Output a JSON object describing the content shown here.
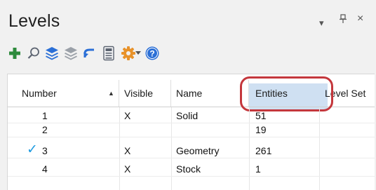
{
  "panel": {
    "title": "Levels",
    "dropdown_glyph": "▾",
    "pin_glyph": "ᚚ",
    "close_glyph": "×"
  },
  "toolbar": {
    "icons": [
      "add-icon",
      "search-icon",
      "layers-icon",
      "layers-gray-icon",
      "undo-icon",
      "calculator-icon",
      "gear-icon",
      "dropdown-arrow-icon",
      "help-icon"
    ],
    "colors": {
      "add": "#2e8b3d",
      "blue": "#2b6fd6",
      "gear": "#e8922a",
      "gray": "#8a8f98"
    }
  },
  "grid": {
    "columns": [
      "Number",
      "Visible",
      "Name",
      "Entities",
      "Level Set"
    ],
    "sort_indicator": "▲",
    "highlight_color": "#c4373c",
    "rows": [
      {
        "number": "1",
        "visible": "X",
        "name": "Solid",
        "entities": "51",
        "level_set": ""
      },
      {
        "number": "2",
        "visible": "",
        "name": "",
        "entities": "19",
        "level_set": ""
      },
      {
        "number": "3",
        "visible": "X",
        "name": "Geometry",
        "entities": "261",
        "level_set": "",
        "active": true
      },
      {
        "number": "4",
        "visible": "X",
        "name": "Stock",
        "entities": "1",
        "level_set": ""
      }
    ],
    "active_mark": "✓"
  }
}
